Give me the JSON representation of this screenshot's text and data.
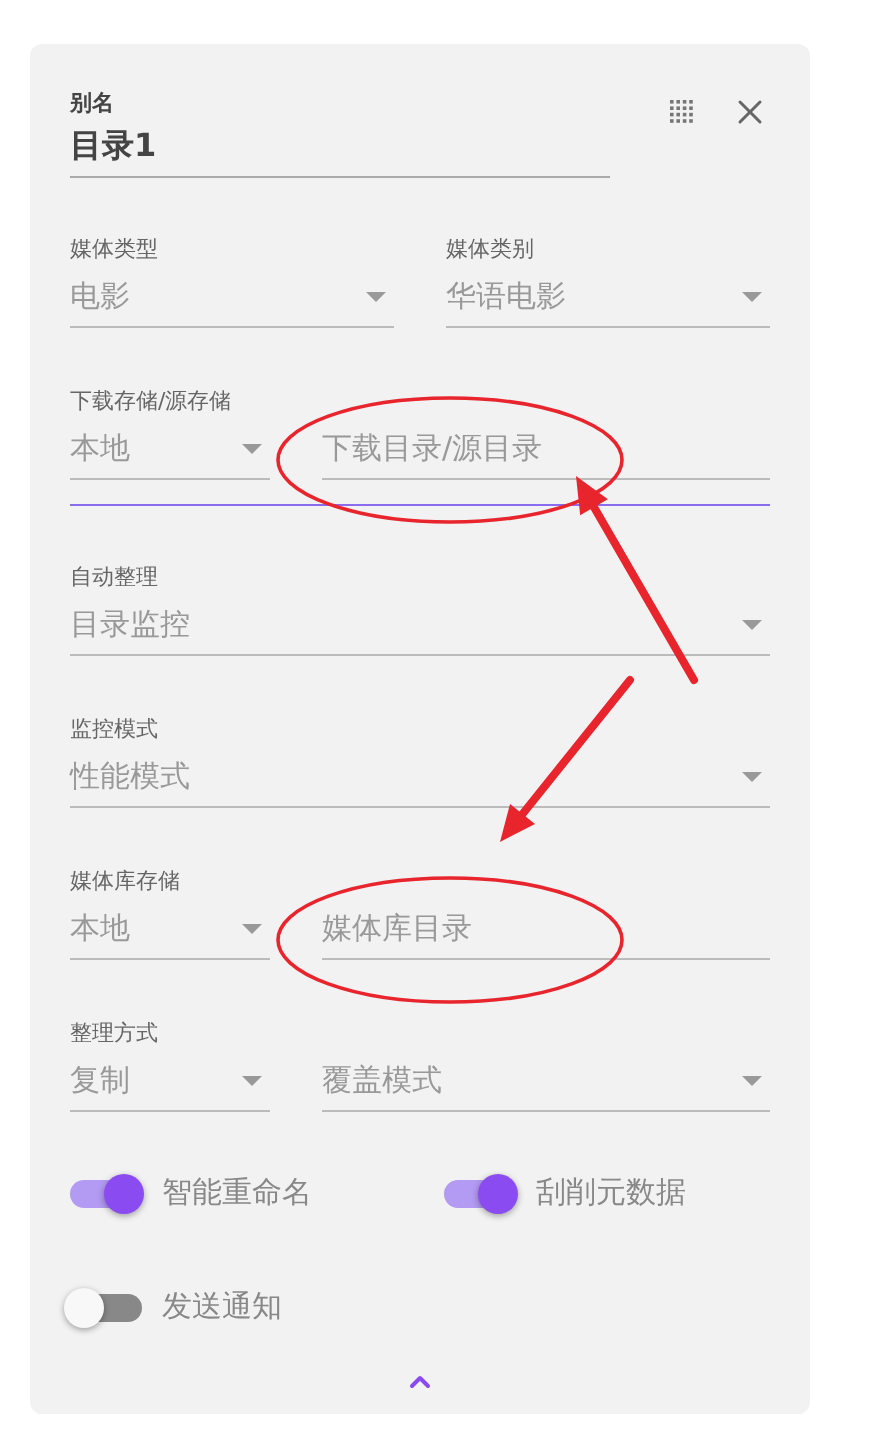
{
  "alias": {
    "label": "别名",
    "value": "目录1"
  },
  "rows": [
    {
      "focused": false,
      "fields": [
        {
          "kind": "select",
          "label": "媒体类型",
          "value": "电影"
        },
        {
          "kind": "select",
          "label": "媒体类别",
          "value": "华语电影"
        }
      ]
    },
    {
      "focused": true,
      "fields": [
        {
          "kind": "select",
          "label": "下载存储/源存储",
          "value": "本地"
        },
        {
          "kind": "text",
          "placeholder": "下载目录/源目录",
          "circled": true
        }
      ]
    },
    {
      "focused": false,
      "fields": [
        {
          "kind": "select",
          "label": "自动整理",
          "value": "目录监控"
        }
      ]
    },
    {
      "focused": false,
      "fields": [
        {
          "kind": "select",
          "label": "监控模式",
          "value": "性能模式"
        }
      ]
    },
    {
      "focused": false,
      "fields": [
        {
          "kind": "select",
          "label": "媒体库存储",
          "value": "本地"
        },
        {
          "kind": "text",
          "placeholder": "媒体库目录",
          "circled": true
        }
      ]
    },
    {
      "focused": false,
      "fields": [
        {
          "kind": "select",
          "label": "整理方式",
          "value": "复制"
        },
        {
          "kind": "select",
          "value": "覆盖模式"
        }
      ]
    }
  ],
  "switches": [
    {
      "label": "智能重命名",
      "on": true
    },
    {
      "label": "刮削元数据",
      "on": true
    },
    {
      "label": "发送通知",
      "on": false
    }
  ]
}
